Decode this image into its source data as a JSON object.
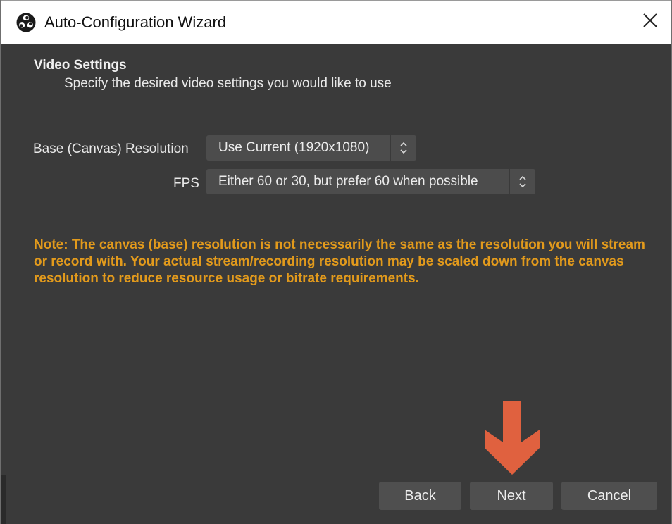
{
  "window": {
    "title": "Auto-Configuration Wizard",
    "app_icon": "obs-logo-icon",
    "close_icon": "close-icon"
  },
  "page": {
    "heading": "Video Settings",
    "subheading": "Specify the desired video settings you would like to use"
  },
  "fields": {
    "resolution": {
      "label": "Base (Canvas) Resolution",
      "value": "Use Current (1920x1080)",
      "icon": "spinner-arrows-icon"
    },
    "fps": {
      "label": "FPS",
      "value": "Either 60 or 30, but prefer 60 when possible",
      "icon": "spinner-arrows-icon"
    }
  },
  "note": "Note: The canvas (base) resolution is not necessarily the same as the resolution you will stream or record with. Your actual stream/recording resolution may be scaled down from the canvas resolution to reduce resource usage or bitrate requirements.",
  "buttons": {
    "back": "Back",
    "next": "Next",
    "cancel": "Cancel"
  },
  "annotation": {
    "icon": "down-arrow-icon",
    "color": "#e0613f"
  },
  "colors": {
    "background": "#3a3a3a",
    "note_text": "#e29a1c",
    "button_bg": "#4f4f4f"
  }
}
